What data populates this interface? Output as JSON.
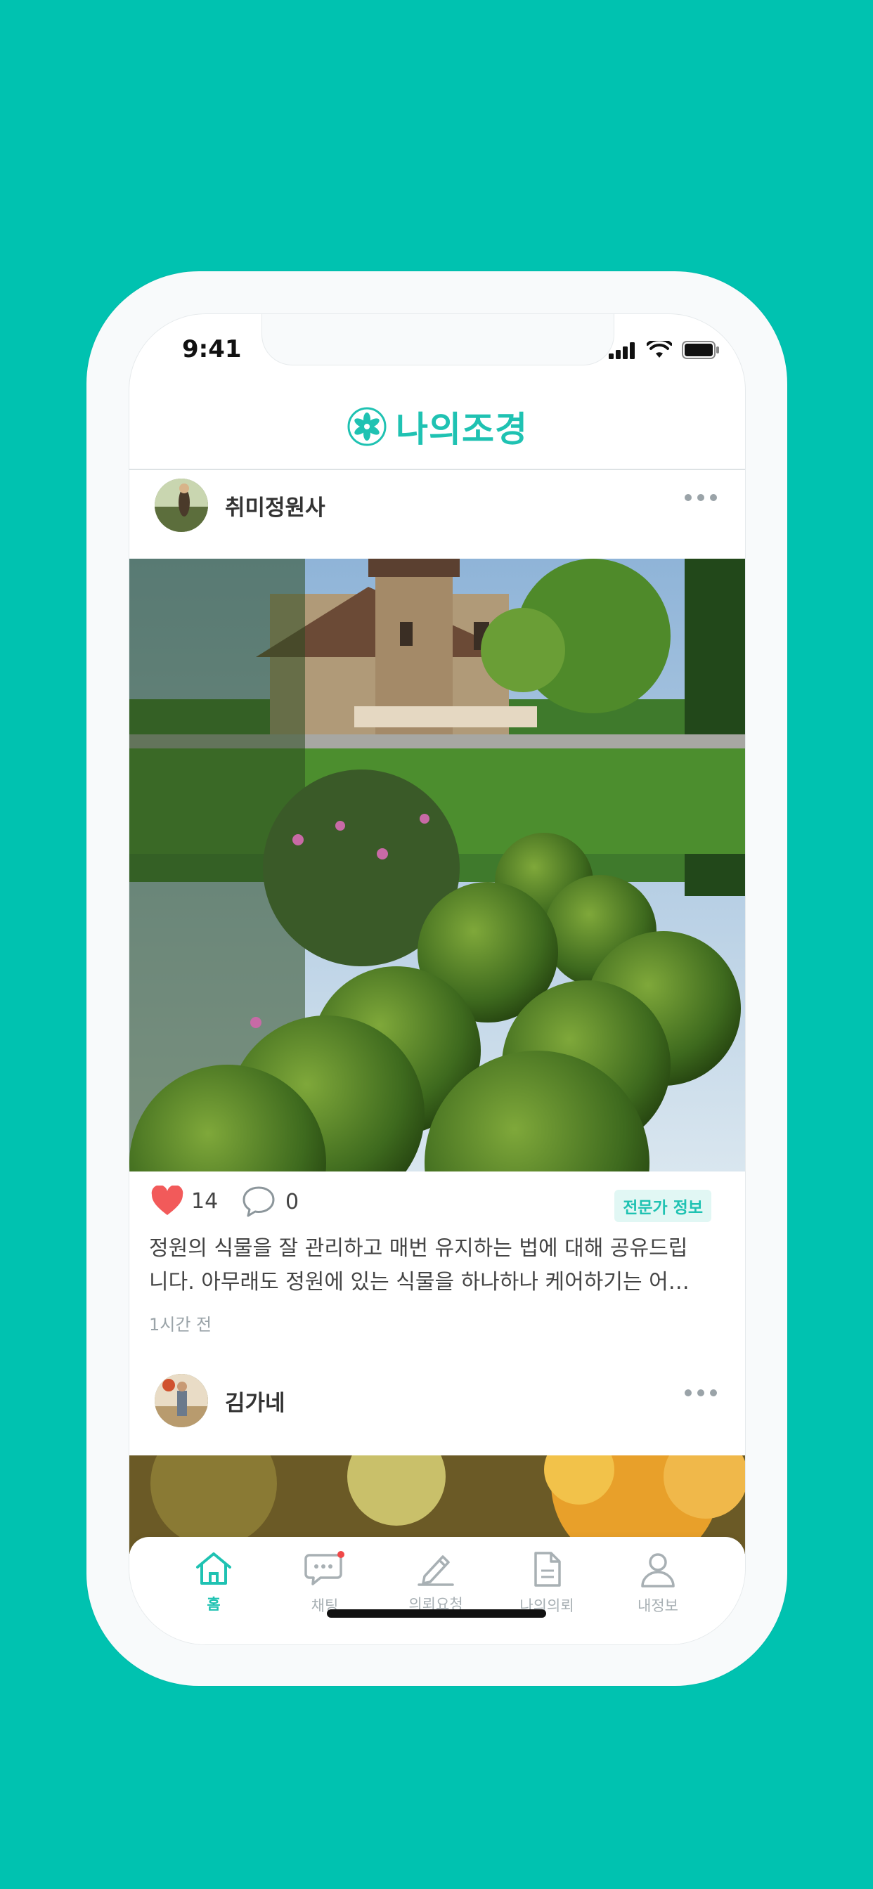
{
  "status": {
    "time": "9:41"
  },
  "app": {
    "title": "나의조경"
  },
  "posts": [
    {
      "author": "취미정원사",
      "likes": "14",
      "comments": "0",
      "badge": "전문가 정보",
      "caption_line1": "정원의 식물을 잘 관리하고 매번 유지하는 법에 대해 공유드립",
      "caption_line2": "니다. 아무래도 정원에 있는 식물을 하나하나 케어하기는 어…",
      "time_ago": "1시간 전"
    },
    {
      "author": "김가네"
    }
  ],
  "tabs": [
    {
      "label": "홈",
      "icon": "home-icon",
      "active": true
    },
    {
      "label": "채팅",
      "icon": "chat-icon",
      "active": false
    },
    {
      "label": "의뢰요청",
      "icon": "pen-icon",
      "active": false
    },
    {
      "label": "나의의뢰",
      "icon": "document-icon",
      "active": false
    },
    {
      "label": "내정보",
      "icon": "person-icon",
      "active": false
    }
  ],
  "colors": {
    "brand": "#1FC2B2",
    "background": "#00C2B0",
    "like": "#F25A5A",
    "notification_dot": "#F04848"
  }
}
